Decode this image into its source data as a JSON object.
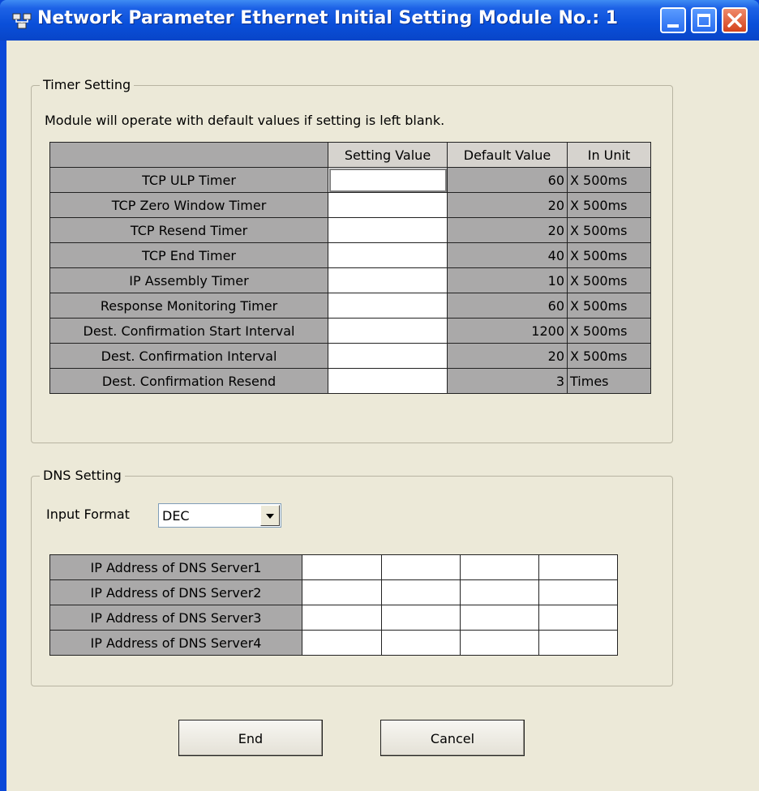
{
  "window": {
    "title": "Network Parameter  Ethernet Initial Setting Module No.: 1",
    "icon": "network-parameter-icon",
    "controls": [
      "minimize-icon",
      "maximize-icon",
      "close-icon"
    ]
  },
  "timer_setting": {
    "group_title": "Timer Setting",
    "note": "Module will operate with default values if setting is left blank.",
    "columns": [
      "",
      "Setting Value",
      "Default Value",
      "In Unit"
    ],
    "rows": [
      {
        "name": "TCP ULP Timer",
        "setting": "",
        "default": "60",
        "unit": "X 500ms"
      },
      {
        "name": "TCP Zero Window Timer",
        "setting": "",
        "default": "20",
        "unit": "X 500ms"
      },
      {
        "name": "TCP Resend Timer",
        "setting": "",
        "default": "20",
        "unit": "X 500ms"
      },
      {
        "name": "TCP End Timer",
        "setting": "",
        "default": "40",
        "unit": "X 500ms"
      },
      {
        "name": "IP Assembly Timer",
        "setting": "",
        "default": "10",
        "unit": "X 500ms"
      },
      {
        "name": "Response Monitoring Timer",
        "setting": "",
        "default": "60",
        "unit": "X 500ms"
      },
      {
        "name": "Dest. Confirmation Start Interval",
        "setting": "",
        "default": "1200",
        "unit": "X 500ms"
      },
      {
        "name": "Dest. Confirmation Interval",
        "setting": "",
        "default": "20",
        "unit": "X 500ms"
      },
      {
        "name": "Dest. Confirmation Resend",
        "setting": "",
        "default": "3",
        "unit": "Times"
      }
    ]
  },
  "dns_setting": {
    "group_title": "DNS Setting",
    "input_format_label": "Input Format",
    "input_format_value": "DEC",
    "servers": [
      {
        "label": "IP Address of DNS Server1",
        "octets": [
          "",
          "",
          "",
          ""
        ]
      },
      {
        "label": "IP Address of DNS Server2",
        "octets": [
          "",
          "",
          "",
          ""
        ]
      },
      {
        "label": "IP Address of DNS Server3",
        "octets": [
          "",
          "",
          "",
          ""
        ]
      },
      {
        "label": "IP Address of DNS Server4",
        "octets": [
          "",
          "",
          "",
          ""
        ]
      }
    ]
  },
  "buttons": {
    "end": "End",
    "cancel": "Cancel"
  }
}
